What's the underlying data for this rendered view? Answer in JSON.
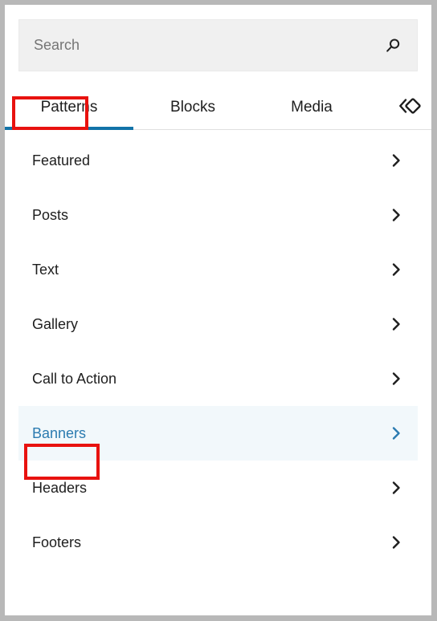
{
  "window": {
    "border_color": "#b8b8b8",
    "panel_background": "#ffffff"
  },
  "search": {
    "placeholder": "Search",
    "value": "",
    "icon": "search-icon",
    "background": "#f0f0f0"
  },
  "tabs": {
    "active": "Patterns",
    "active_underline_color": "#1273a8",
    "items": [
      {
        "label": "Patterns",
        "active": true
      },
      {
        "label": "Blocks",
        "active": false
      },
      {
        "label": "Media",
        "active": false
      }
    ],
    "toggle_icon": "chevron-left-diamond-icon"
  },
  "categories": {
    "chevron_icon": "chevron-right-icon",
    "selected": "Banners",
    "selected_background": "#f2f8fb",
    "selected_text_color": "#2b7bb0",
    "items": [
      {
        "label": "Featured",
        "selected": false
      },
      {
        "label": "Posts",
        "selected": false
      },
      {
        "label": "Text",
        "selected": false
      },
      {
        "label": "Gallery",
        "selected": false
      },
      {
        "label": "Call to Action",
        "selected": false
      },
      {
        "label": "Banners",
        "selected": true
      },
      {
        "label": "Headers",
        "selected": false
      },
      {
        "label": "Footers",
        "selected": false
      }
    ]
  },
  "annotations": {
    "color": "#e8120f",
    "boxes": [
      {
        "target": "Patterns"
      },
      {
        "target": "Banners"
      }
    ]
  }
}
